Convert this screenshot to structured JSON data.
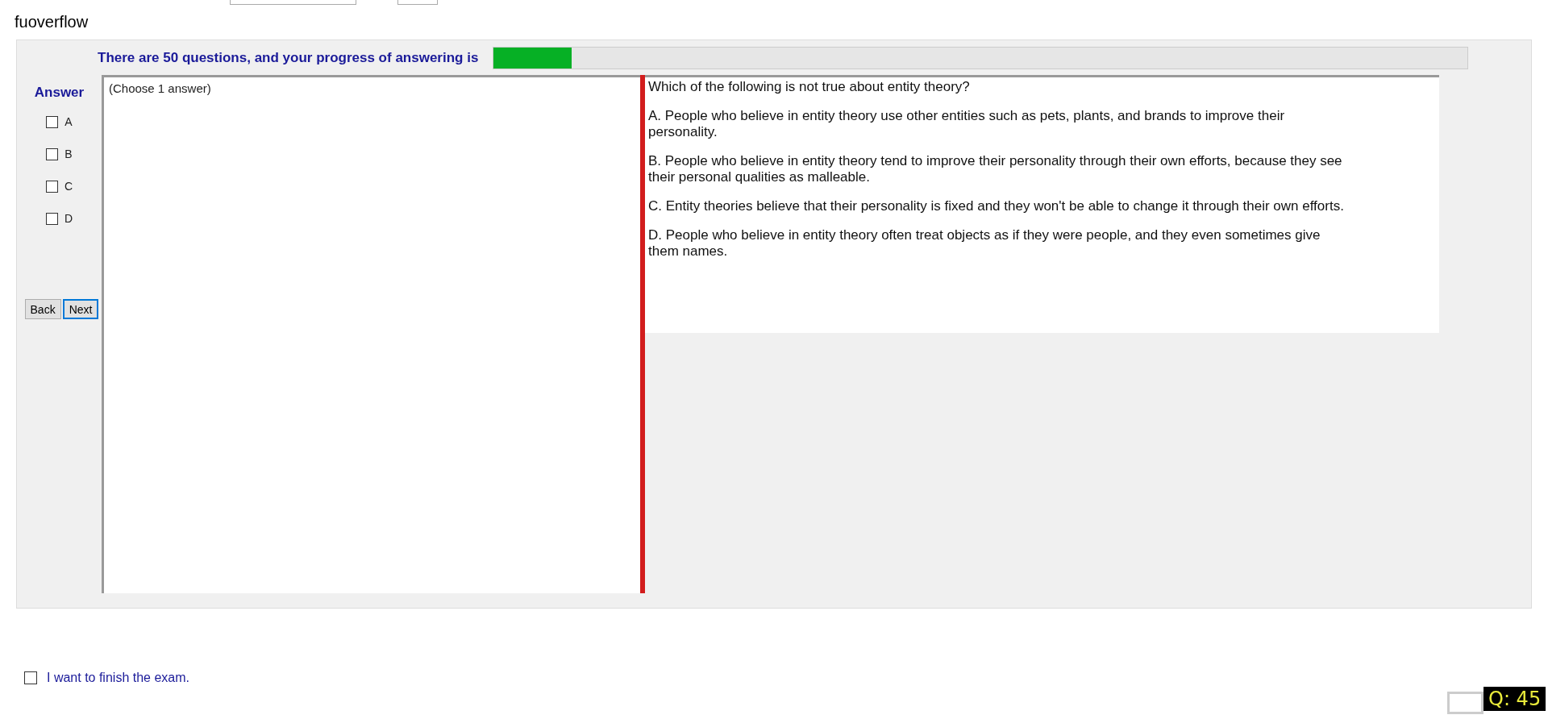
{
  "app_title": "fuoverflow",
  "progress": {
    "label": "There are 50 questions, and your progress of answering is",
    "level": 0.08
  },
  "answer": {
    "title": "Answer",
    "options": [
      {
        "label": "A",
        "checked": false
      },
      {
        "label": "B",
        "checked": false
      },
      {
        "label": "C",
        "checked": false
      },
      {
        "label": "D",
        "checked": false
      }
    ]
  },
  "buttons": [
    {
      "label": "Back",
      "selected": false
    },
    {
      "label": "Next",
      "selected": true
    }
  ],
  "answer_hint": "(Choose 1 answer)",
  "question": [
    "Which of the following is not true about entity theory?",
    "A.  People who believe in entity theory use other entities such as pets, plants, and brands to improve their personality.",
    "B.  People who believe in entity theory tend to improve their personality through their own efforts, because they see their personal qualities as malleable.",
    "C.  Entity theories believe that their personality is fixed and they won't be able to change it through their own efforts.",
    "D.  People who believe in entity theory often treat objects as if they were people, and they even sometimes give them names."
  ],
  "finish": {
    "label": "I want to finish the exam.",
    "checked": false
  },
  "question_badge": "Q: 45"
}
